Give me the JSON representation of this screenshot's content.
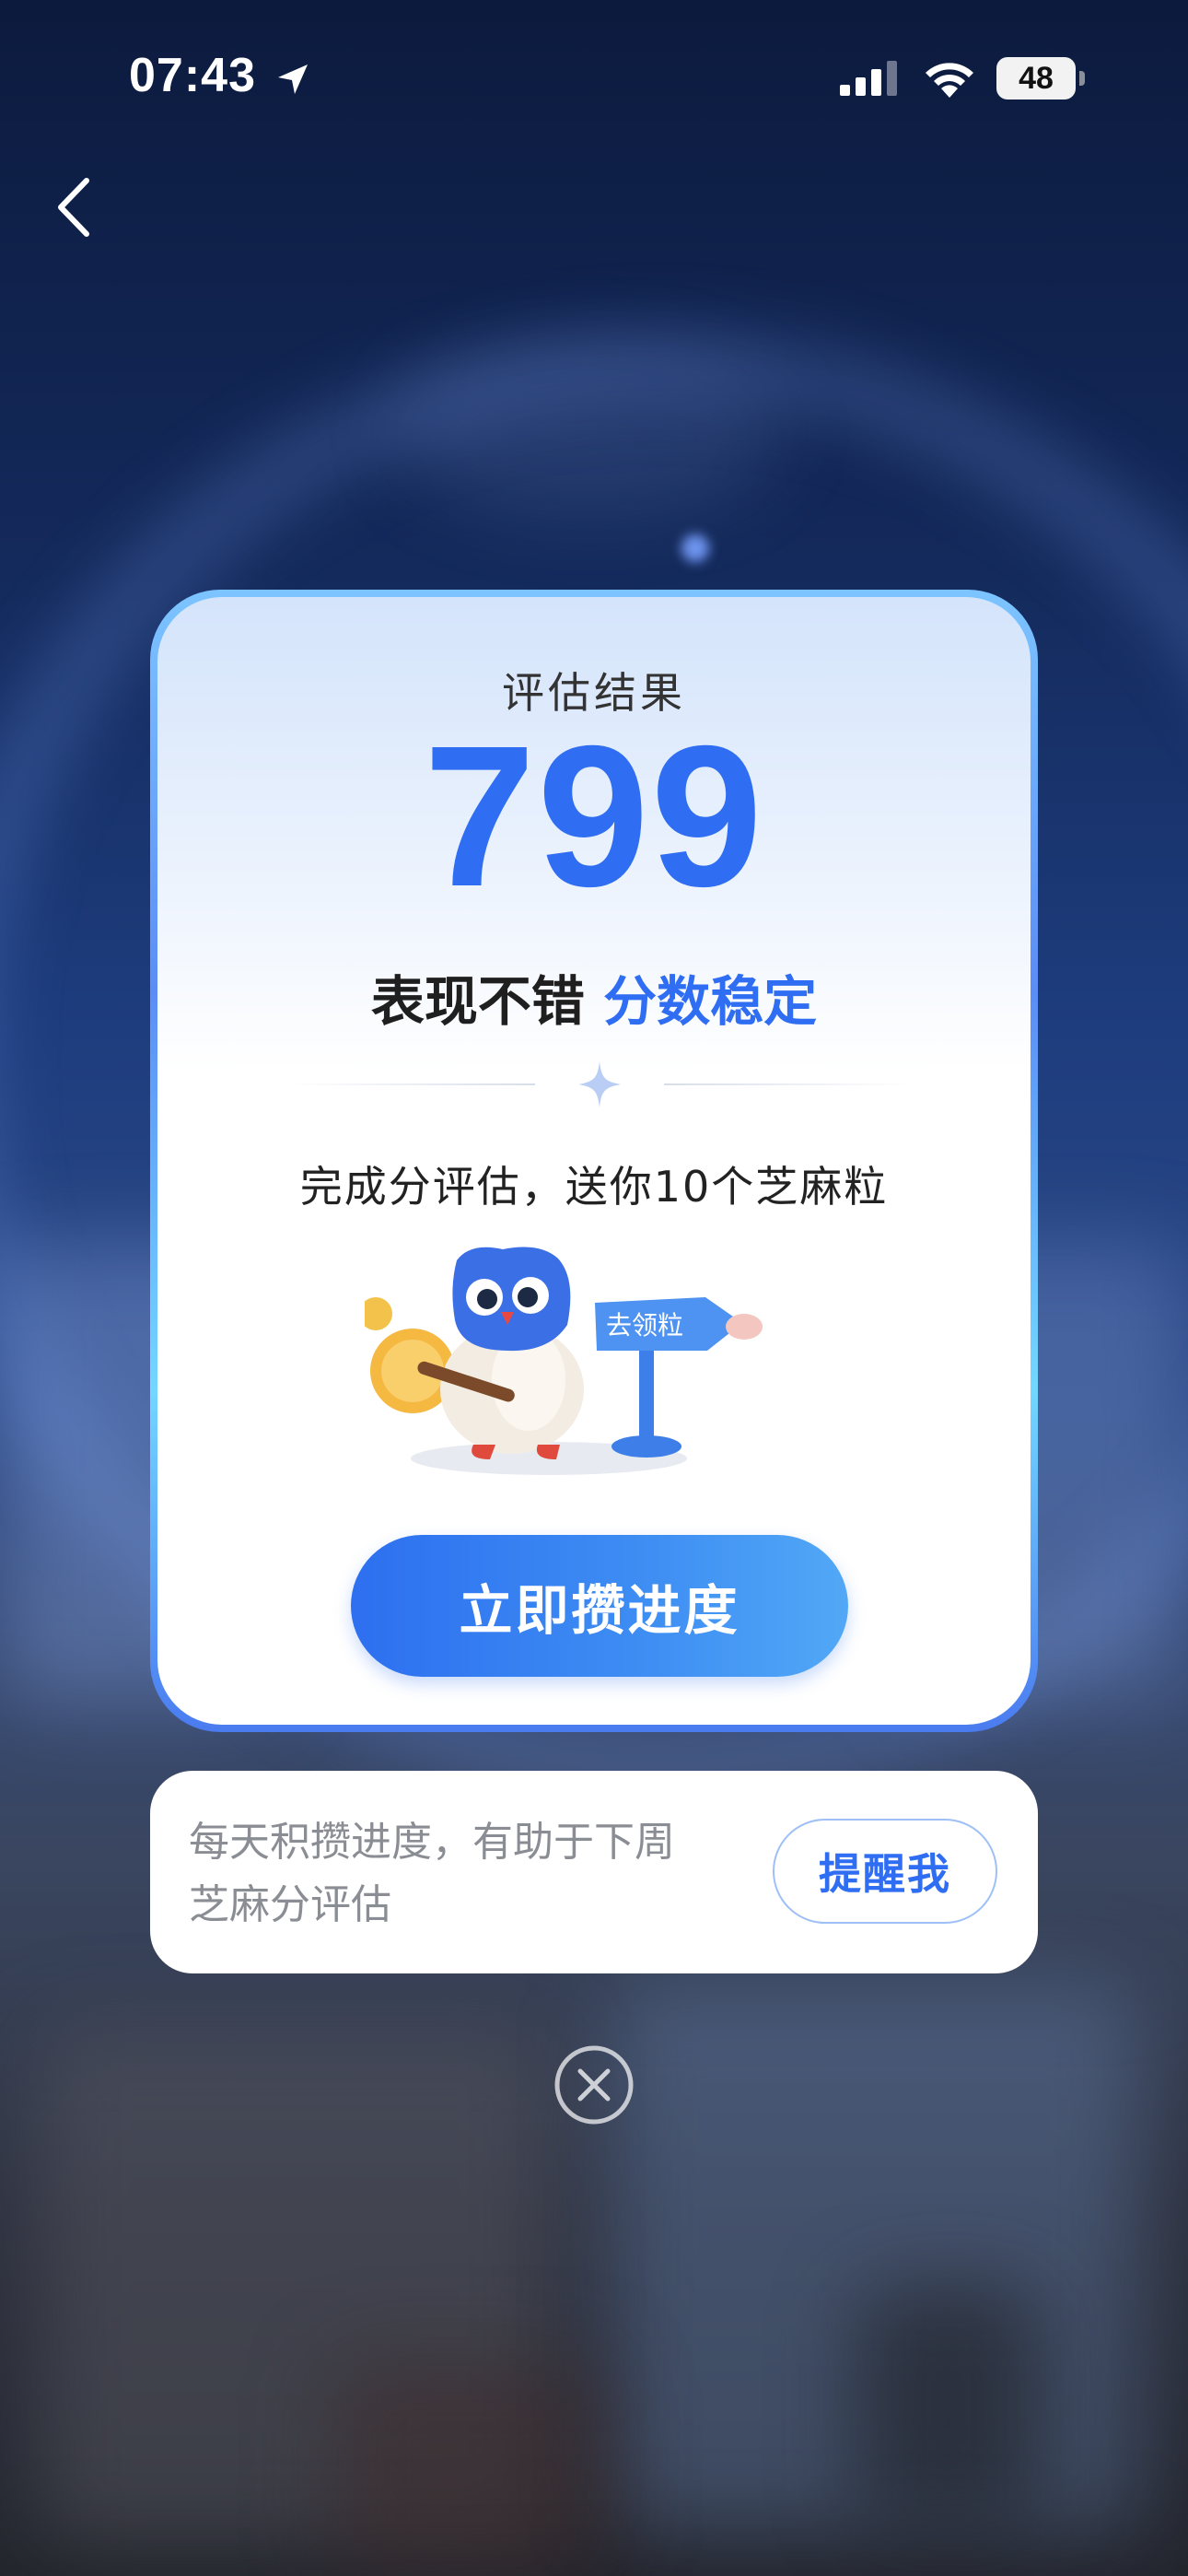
{
  "status_bar": {
    "time": "07:43",
    "battery": "48"
  },
  "evaluation": {
    "title": "评估结果",
    "score": "799",
    "verdict_prefix": "表现不错",
    "verdict_highlight": "分数稳定",
    "reward_text": "完成分评估，送你10个芝麻粒",
    "sign_text": "去领粒",
    "cta_label": "立即攒进度"
  },
  "reminder": {
    "text_line1": "每天积攒进度，有助于下周",
    "text_line2": "芝麻分评估",
    "button_label": "提醒我"
  },
  "colors": {
    "accent": "#2f6ef2",
    "cta_start": "#2d6ff0",
    "cta_end": "#52a8f6"
  },
  "icons": [
    "location-arrow-icon",
    "signal-icon",
    "wifi-icon",
    "battery-icon",
    "back-chevron-icon",
    "sparkle-icon",
    "close-circle-icon"
  ]
}
